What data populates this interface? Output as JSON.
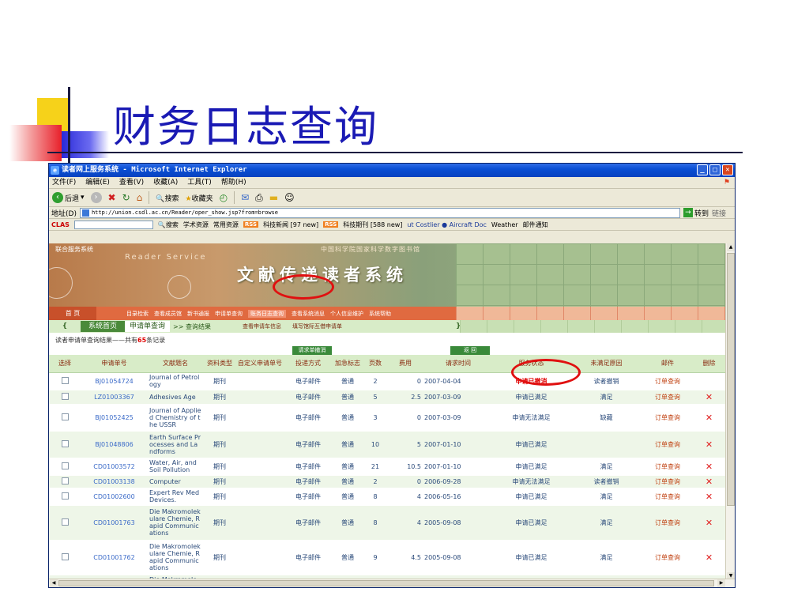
{
  "slide": {
    "title": "财务日志查询"
  },
  "window": {
    "title": "读者网上服务系统 - Microsoft Internet Explorer",
    "menu": [
      "文件(F)",
      "编辑(E)",
      "查看(V)",
      "收藏(A)",
      "工具(T)",
      "帮助(H)"
    ],
    "toolbar": {
      "back": "后退",
      "search": "搜索",
      "favorites": "收藏夹"
    },
    "address": {
      "label": "地址(D)",
      "url": "http://union.csdl.ac.cn/Reader/oper_show.jsp?from=browse",
      "go": "转到",
      "links": "链接"
    },
    "linkbar": {
      "clas": "CLAS",
      "search": "搜索",
      "academic": "学术资源",
      "common": "常用资源",
      "rss": "RSS",
      "news": "科技新闻 [97 new]",
      "journals": "科技期刊 [588 new]",
      "ticker": "ut Costlier ● Aircraft Doc",
      "weather": "Weather",
      "mail": "邮件通知"
    }
  },
  "banner": {
    "system_label": "联合服务系统",
    "reader_service": "Reader Service",
    "main_title": "文献传递读者系统",
    "library": "中国科学院国家科学数字图书馆"
  },
  "nav": {
    "home": "首 页",
    "items": [
      "目录检索",
      "查看成员馆",
      "新书通报",
      "申请单查询",
      "账务日志查询",
      "查看系统消息",
      "个人信息维护",
      "系统帮助"
    ]
  },
  "subnav": {
    "home_tab": "系统首页",
    "query_tab": "申请单查询",
    "crumb": ">> 查询结果",
    "links": [
      "查看申请车信息",
      "填写馆际互借申请单"
    ]
  },
  "summary": {
    "prefix": "读者申请单查询结果——共有",
    "count": "65",
    "suffix": "条记录"
  },
  "actions": {
    "cancel": "请求单撤消",
    "back": "返 回"
  },
  "table": {
    "headers": [
      "选择",
      "申请单号",
      "文献题名",
      "资料类型",
      "自定义申请单号",
      "投递方式",
      "加急标志",
      "页数",
      "费用",
      "请求时间",
      "服务状态",
      "未满足原因",
      "邮件",
      "删除"
    ],
    "rows": [
      {
        "id": "BJ01054724",
        "title": "Journal of Petrology",
        "type": "期刊",
        "custom": "",
        "delivery": "电子邮件",
        "urgent": "普通",
        "pages": "2",
        "fee": "0",
        "date": "2007-04-04",
        "status": "申请已撤消",
        "reason": "读者撤销",
        "mail": "订单查询",
        "deletable": false
      },
      {
        "id": "LZ01003367",
        "title": "Adhesives Age",
        "type": "期刊",
        "custom": "",
        "delivery": "电子邮件",
        "urgent": "普通",
        "pages": "5",
        "fee": "2.5",
        "date": "2007-03-09",
        "status": "申请已满足",
        "reason": "满足",
        "mail": "订单查询",
        "deletable": true
      },
      {
        "id": "BJ01052425",
        "title": "Journal of Applied Chemistry of the USSR",
        "type": "期刊",
        "custom": "",
        "delivery": "电子邮件",
        "urgent": "普通",
        "pages": "3",
        "fee": "0",
        "date": "2007-03-09",
        "status": "申请无法满足",
        "reason": "缺藏",
        "mail": "订单查询",
        "deletable": true
      },
      {
        "id": "BJ01048806",
        "title": "Earth Surface Processes and Landforms",
        "type": "期刊",
        "custom": "",
        "delivery": "电子邮件",
        "urgent": "普通",
        "pages": "10",
        "fee": "5",
        "date": "2007-01-10",
        "status": "申请已满足",
        "reason": "",
        "mail": "订单查询",
        "deletable": true
      },
      {
        "id": "CD01003572",
        "title": "Water, Air, and Soil Pollution",
        "type": "期刊",
        "custom": "",
        "delivery": "电子邮件",
        "urgent": "普通",
        "pages": "21",
        "fee": "10.5",
        "date": "2007-01-10",
        "status": "申请已满足",
        "reason": "满足",
        "mail": "订单查询",
        "deletable": true
      },
      {
        "id": "CD01003138",
        "title": "Computer",
        "type": "期刊",
        "custom": "",
        "delivery": "电子邮件",
        "urgent": "普通",
        "pages": "2",
        "fee": "0",
        "date": "2006-09-28",
        "status": "申请无法满足",
        "reason": "读者撤销",
        "mail": "订单查询",
        "deletable": true
      },
      {
        "id": "CD01002600",
        "title": "Expert Rev Med Devices.",
        "type": "期刊",
        "custom": "",
        "delivery": "电子邮件",
        "urgent": "普通",
        "pages": "8",
        "fee": "4",
        "date": "2006-05-16",
        "status": "申请已满足",
        "reason": "满足",
        "mail": "订单查询",
        "deletable": true
      },
      {
        "id": "CD01001763",
        "title": "Die Makromolekulare Chemie, Rapid Communications",
        "type": "期刊",
        "custom": "",
        "delivery": "电子邮件",
        "urgent": "普通",
        "pages": "8",
        "fee": "4",
        "date": "2005-09-08",
        "status": "申请已满足",
        "reason": "满足",
        "mail": "订单查询",
        "deletable": true
      },
      {
        "id": "CD01001762",
        "title": "Die Makromolekulare Chemie, Rapid Communications",
        "type": "期刊",
        "custom": "",
        "delivery": "电子邮件",
        "urgent": "普通",
        "pages": "9",
        "fee": "4.5",
        "date": "2005-09-08",
        "status": "申请已满足",
        "reason": "满足",
        "mail": "订单查询",
        "deletable": true
      },
      {
        "id": "",
        "title": "Die Makromole",
        "type": "",
        "custom": "",
        "delivery": "",
        "urgent": "",
        "pages": "",
        "fee": "",
        "date": "",
        "status": "",
        "reason": "",
        "mail": "",
        "deletable": false
      }
    ]
  },
  "colors": {
    "title_blue": "#1a1ab4",
    "highlight_red": "#e01010",
    "header_green": "#d8ecc8",
    "nav_orange": "#e06a40"
  },
  "icons": {
    "delete": "close-x-icon",
    "go": "arrow-right-icon",
    "back": "arrow-left-icon"
  }
}
